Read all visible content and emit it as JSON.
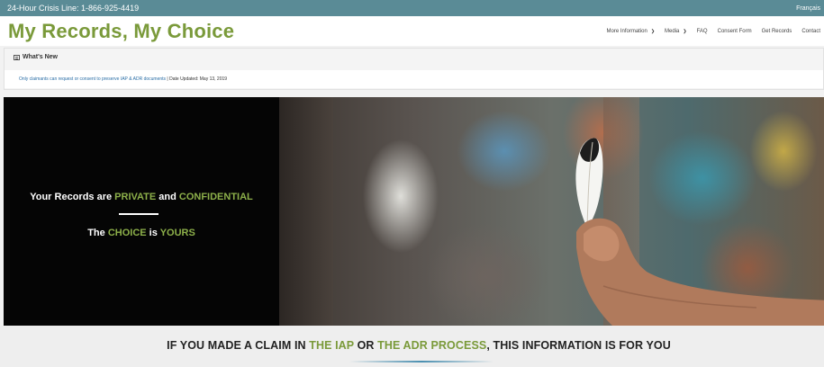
{
  "topbar": {
    "crisis_line": "24-Hour Crisis Line: 1-866-925-4419",
    "language": "Français"
  },
  "header": {
    "logo_part1": "My Records,",
    "logo_part2": " My Choice",
    "nav": [
      {
        "label": "More Information",
        "has_dropdown": true
      },
      {
        "label": "Media",
        "has_dropdown": true
      },
      {
        "label": "FAQ",
        "has_dropdown": false
      },
      {
        "label": "Consent Form",
        "has_dropdown": false
      },
      {
        "label": "Get Records",
        "has_dropdown": false
      },
      {
        "label": "Contact",
        "has_dropdown": false
      }
    ]
  },
  "whats_new": {
    "title": "What's New",
    "item_link": "Only claimants can request or consent to preserve IAP & ADR documents",
    "item_date": " | Date Updated: May 13, 2019"
  },
  "hero": {
    "line1_a": "Your Records are ",
    "line1_b": "PRIVATE",
    "line1_c": " and ",
    "line1_d": "CONFIDENTIAL",
    "line2_a": "The ",
    "line2_b": "CHOICE",
    "line2_c": " is ",
    "line2_d": "YOURS"
  },
  "banner": {
    "part1": "IF YOU MADE A CLAIM IN ",
    "part2": "THE IAP",
    "part3": " OR ",
    "part4": "THE ADR PROCESS",
    "part5": ", THIS INFORMATION IS FOR YOU"
  },
  "colors": {
    "topbar": "#5a8b96",
    "accent_green": "#8db04a",
    "logo_teal": "#4f8a92"
  }
}
